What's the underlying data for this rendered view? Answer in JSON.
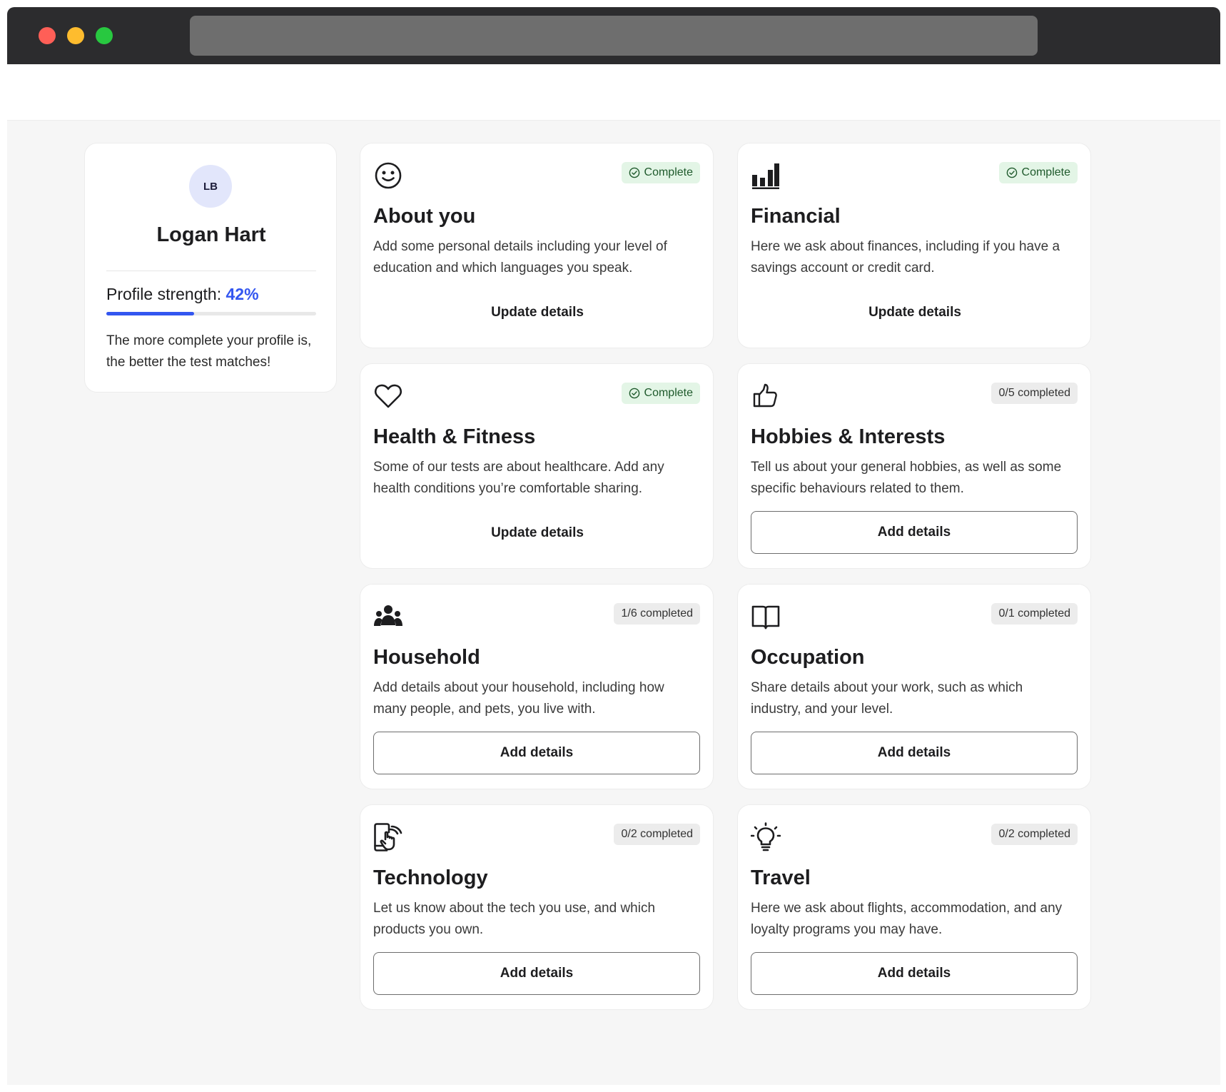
{
  "profile": {
    "initials": "LB",
    "name": "Logan Hart",
    "strength_label": "Profile strength:",
    "strength_value": "42%",
    "strength_fraction": 0.42,
    "note": "The more complete your profile is, the better the test matches!"
  },
  "colors": {
    "accent": "#3356f0",
    "complete_badge_bg": "#e3f5e6",
    "complete_badge_text": "#1f5a2c",
    "partial_badge_bg": "#ececec"
  },
  "cards": [
    {
      "icon": "smiley-face-icon",
      "status": "Complete",
      "status_type": "complete",
      "title": "About you",
      "description": "Add some personal details including your level of education and which languages you speak.",
      "action": "Update details"
    },
    {
      "icon": "bar-chart-icon",
      "status": "Complete",
      "status_type": "complete",
      "title": "Financial",
      "description": "Here we ask about finances, including if you have a savings account or credit card.",
      "action": "Update details"
    },
    {
      "icon": "heart-icon",
      "status": "Complete",
      "status_type": "complete",
      "title": "Health & Fitness",
      "description": "Some of our tests are about healthcare. Add any health conditions you’re comfortable sharing.",
      "action": "Update details"
    },
    {
      "icon": "thumbs-up-icon",
      "status": "0/5 completed",
      "status_type": "partial",
      "title": "Hobbies & Interests",
      "description": "Tell us about your general hobbies, as well as some specific behaviours related to them.",
      "action": "Add details"
    },
    {
      "icon": "people-group-icon",
      "status": "1/6 completed",
      "status_type": "partial",
      "title": "Household",
      "description": "Add details about your household, including how many people, and pets, you live with.",
      "action": "Add details"
    },
    {
      "icon": "open-book-icon",
      "status": "0/1 completed",
      "status_type": "partial",
      "title": "Occupation",
      "description": "Share details about your work, such as which industry, and your level.",
      "action": "Add details"
    },
    {
      "icon": "mobile-touch-icon",
      "status": "0/2 completed",
      "status_type": "partial",
      "title": "Technology",
      "description": "Let us know about the tech you use, and which products you own.",
      "action": "Add details"
    },
    {
      "icon": "lightbulb-icon",
      "status": "0/2 completed",
      "status_type": "partial",
      "title": "Travel",
      "description": "Here we ask about flights, accommodation, and any loyalty programs you may have.",
      "action": "Add details"
    }
  ]
}
